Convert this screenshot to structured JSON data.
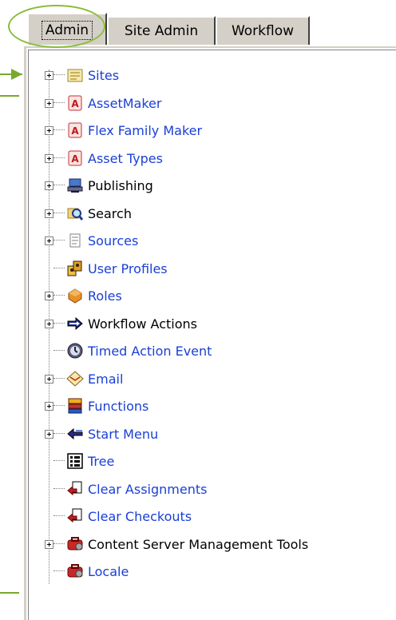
{
  "tabs": [
    {
      "label": "Admin",
      "active": true
    },
    {
      "label": "Site Admin",
      "active": false
    },
    {
      "label": "Workflow",
      "active": false
    }
  ],
  "tree": [
    {
      "label": "Sites",
      "icon": "sites-icon",
      "expandable": true,
      "link": true
    },
    {
      "label": "AssetMaker",
      "icon": "assetmaker-icon",
      "expandable": true,
      "link": true
    },
    {
      "label": "Flex Family Maker",
      "icon": "flex-family-icon",
      "expandable": true,
      "link": true
    },
    {
      "label": "Asset Types",
      "icon": "asset-types-icon",
      "expandable": true,
      "link": true
    },
    {
      "label": "Publishing",
      "icon": "publishing-icon",
      "expandable": true,
      "link": false
    },
    {
      "label": "Search",
      "icon": "search-icon",
      "expandable": true,
      "link": false
    },
    {
      "label": "Sources",
      "icon": "sources-icon",
      "expandable": true,
      "link": true
    },
    {
      "label": "User Profiles",
      "icon": "user-profiles-icon",
      "expandable": false,
      "link": true
    },
    {
      "label": "Roles",
      "icon": "roles-icon",
      "expandable": true,
      "link": true
    },
    {
      "label": "Workflow Actions",
      "icon": "workflow-actions-icon",
      "expandable": true,
      "link": false
    },
    {
      "label": "Timed Action Event",
      "icon": "timed-action-icon",
      "expandable": false,
      "link": true
    },
    {
      "label": "Email",
      "icon": "email-icon",
      "expandable": true,
      "link": true
    },
    {
      "label": "Functions",
      "icon": "functions-icon",
      "expandable": true,
      "link": true
    },
    {
      "label": "Start Menu",
      "icon": "start-menu-icon",
      "expandable": true,
      "link": true
    },
    {
      "label": "Tree",
      "icon": "tree-icon",
      "expandable": false,
      "link": true
    },
    {
      "label": "Clear Assignments",
      "icon": "clear-assignments-icon",
      "expandable": false,
      "link": true
    },
    {
      "label": "Clear Checkouts",
      "icon": "clear-checkouts-icon",
      "expandable": false,
      "link": true
    },
    {
      "label": "Content Server Management Tools",
      "icon": "management-tools-icon",
      "expandable": true,
      "link": false
    },
    {
      "label": "Locale",
      "icon": "locale-icon",
      "expandable": false,
      "link": true
    }
  ],
  "colors": {
    "link": "#1a3fd6",
    "accent": "#7aa82e",
    "tab_bg": "#d4d0c8"
  }
}
